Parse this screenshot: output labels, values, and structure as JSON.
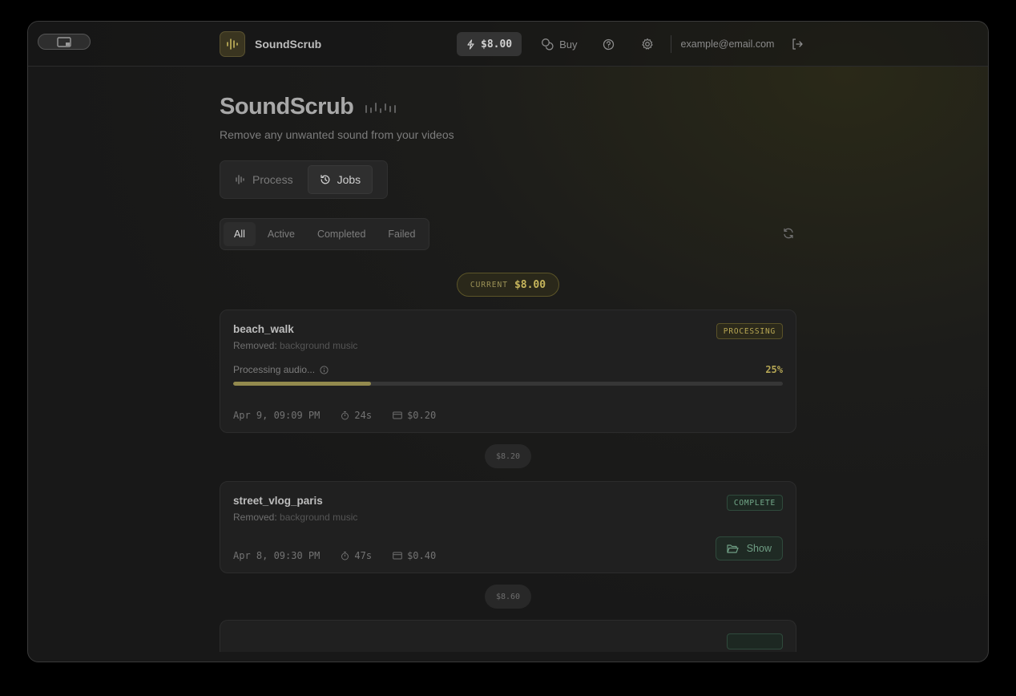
{
  "topbar": {
    "app_name": "SoundScrub",
    "balance": "$8.00",
    "buy_label": "Buy",
    "email": "example@email.com"
  },
  "hero": {
    "title": "SoundScrub",
    "subtitle": "Remove any unwanted sound from your videos"
  },
  "mode_tabs": [
    {
      "label": "Process",
      "active": false
    },
    {
      "label": "Jobs",
      "active": true
    }
  ],
  "filters": [
    {
      "label": "All",
      "active": true
    },
    {
      "label": "Active",
      "active": false
    },
    {
      "label": "Completed",
      "active": false
    },
    {
      "label": "Failed",
      "active": false
    }
  ],
  "current_balance": {
    "label": "CURRENT",
    "value": "$8.00"
  },
  "jobs": [
    {
      "name": "beach_walk",
      "removed_label": "Removed:",
      "removed_value": "background music",
      "status": "PROCESSING",
      "progress_label": "Processing audio...",
      "progress_pct": "25%",
      "progress": 0.25,
      "date": "Apr 9, 09:09 PM",
      "duration": "24s",
      "cost": "$0.20"
    },
    {
      "name": "street_vlog_paris",
      "removed_label": "Removed:",
      "removed_value": "background music",
      "status": "COMPLETE",
      "date": "Apr 8, 09:30 PM",
      "duration": "47s",
      "cost": "$0.40",
      "action_label": "Show"
    }
  ],
  "running_balances": [
    "$8.20",
    "$8.60"
  ],
  "colors": {
    "accent": "#c7b65c",
    "success": "#73a98a",
    "background": "#181818"
  }
}
